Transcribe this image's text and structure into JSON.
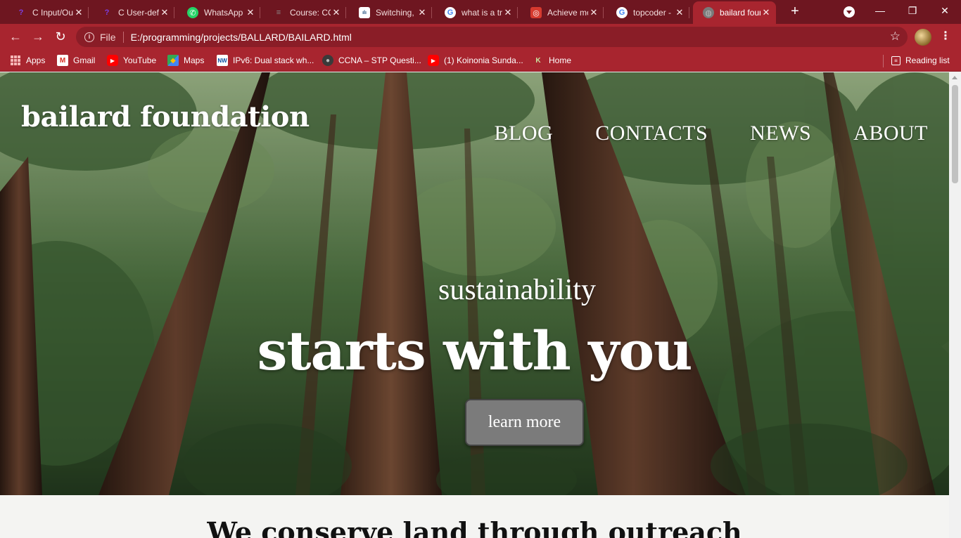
{
  "browser": {
    "tabs": [
      {
        "title": "C Input/Output",
        "icon": "programiz-icon",
        "icon_color": "#7b3fe4",
        "active": false
      },
      {
        "title": "C User-defined",
        "icon": "programiz-icon",
        "icon_color": "#7b3fe4",
        "active": false
      },
      {
        "title": "WhatsApp",
        "icon": "whatsapp-icon",
        "icon_color": "#25d366",
        "active": false
      },
      {
        "title": "Course: CCNA",
        "icon": "course-icon",
        "icon_color": "#8a8a8a",
        "active": false
      },
      {
        "title": "Switching,",
        "icon": "cisco-icon",
        "icon_color": "#ffffff",
        "active": false
      },
      {
        "title": "what is a tree",
        "icon": "google-icon",
        "icon_color": "#ffffff",
        "active": false
      },
      {
        "title": "Achieve more",
        "icon": "achieve-icon",
        "icon_color": "#d63a2f",
        "active": false
      },
      {
        "title": "topcoder -",
        "icon": "google-icon",
        "icon_color": "#ffffff",
        "active": false
      },
      {
        "title": "bailard foundation",
        "icon": "globe-icon",
        "icon_color": "#7a7a7a",
        "active": true
      }
    ],
    "new_tab": "+",
    "address": {
      "scheme_label": "File",
      "url": "E:/programming/projects/BALLARD/BAILARD.html"
    },
    "bookmarks": [
      {
        "label": "Apps",
        "icon": "apps-grid-icon"
      },
      {
        "label": "Gmail",
        "icon": "gmail-icon"
      },
      {
        "label": "YouTube",
        "icon": "youtube-icon"
      },
      {
        "label": "Maps",
        "icon": "maps-icon"
      },
      {
        "label": "IPv6: Dual stack wh...",
        "icon": "nw-icon"
      },
      {
        "label": "CCNA – STP Questi...",
        "icon": "ccna-icon"
      },
      {
        "label": "(1) Koinonia Sunda...",
        "icon": "youtube-icon"
      },
      {
        "label": "Home",
        "icon": "home-k-icon"
      }
    ],
    "reading_list": "Reading list",
    "colors": {
      "frame": "#6e1620",
      "toolbar": "#a8252f"
    }
  },
  "page": {
    "brand": "bailard foundation",
    "nav": [
      "BLOG",
      "CONTACTS",
      "NEWS",
      "ABOUT"
    ],
    "tagline_small": "sustainability",
    "tagline_big": "starts with you",
    "cta_label": "learn more",
    "section_heading": "We conserve land through outreach"
  }
}
